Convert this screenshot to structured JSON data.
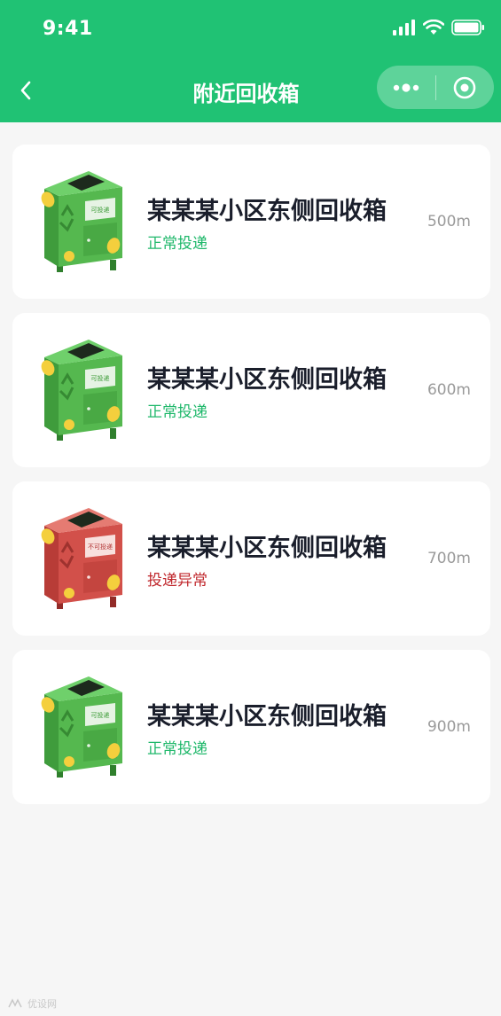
{
  "status_bar": {
    "time": "9:41"
  },
  "nav": {
    "title": "附近回收箱",
    "back_icon": "chevron-left-icon",
    "more_icon": "more-dots-icon",
    "close_icon": "target-circle-icon"
  },
  "colors": {
    "brand_green": "#20c274",
    "status_normal": "#20b86b",
    "status_abnormal": "#c0282d"
  },
  "bins": [
    {
      "name": "某某某小区东侧回收箱",
      "status": "正常投递",
      "status_type": "normal",
      "distance": "500m",
      "bin_label": "可投递",
      "bin_color": "green"
    },
    {
      "name": "某某某小区东侧回收箱",
      "status": "正常投递",
      "status_type": "normal",
      "distance": "600m",
      "bin_label": "可投递",
      "bin_color": "green"
    },
    {
      "name": "某某某小区东侧回收箱",
      "status": "投递异常",
      "status_type": "abnormal",
      "distance": "700m",
      "bin_label": "不可投递",
      "bin_color": "red"
    },
    {
      "name": "某某某小区东侧回收箱",
      "status": "正常投递",
      "status_type": "normal",
      "distance": "900m",
      "bin_label": "可投递",
      "bin_color": "green"
    }
  ],
  "watermark": {
    "text": "优设网"
  }
}
